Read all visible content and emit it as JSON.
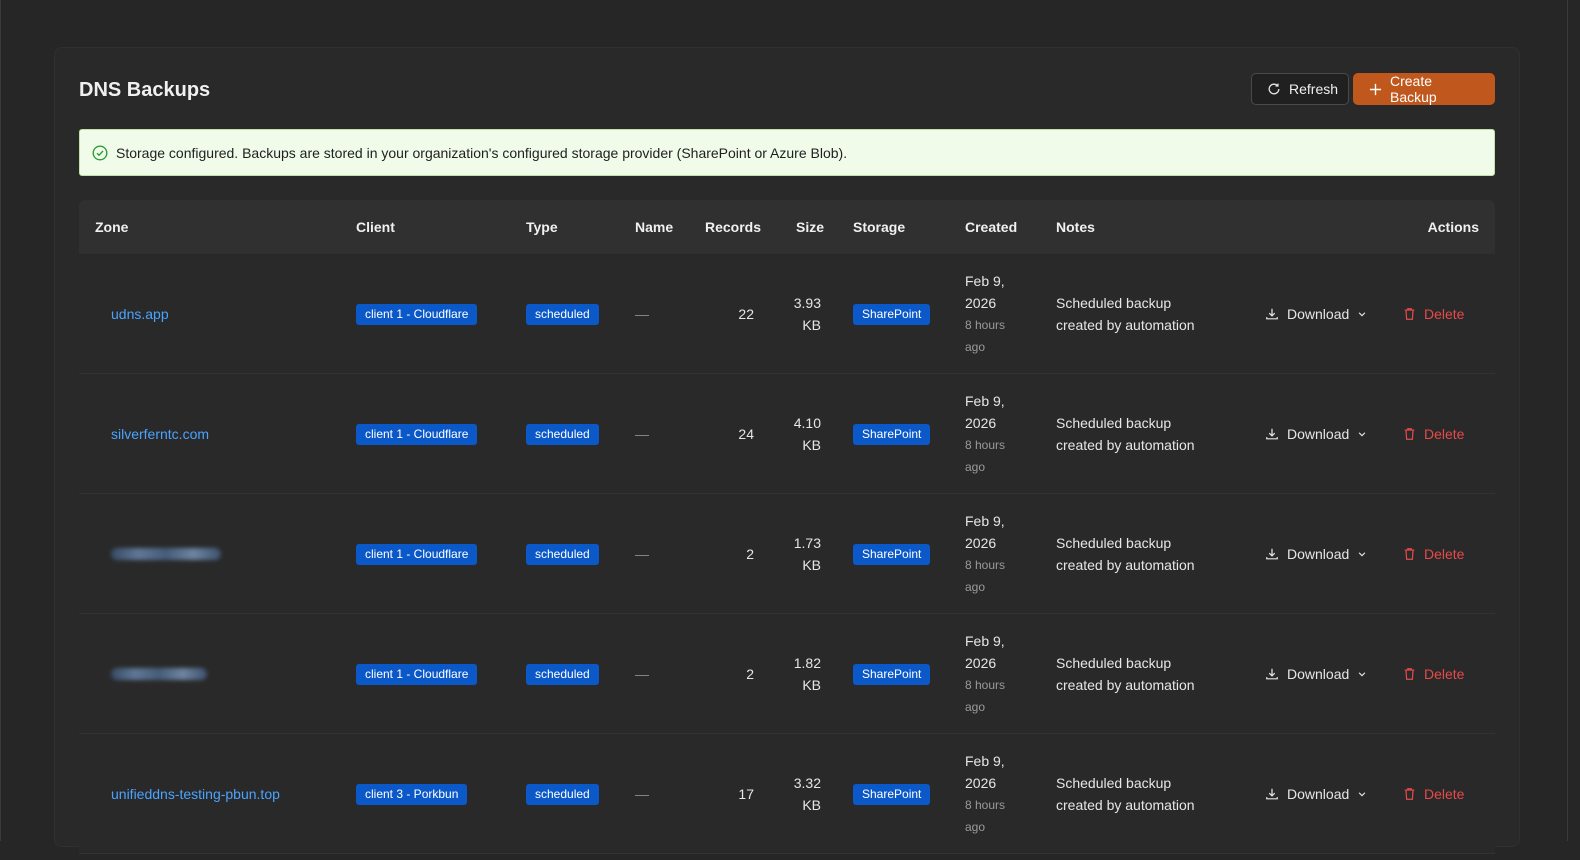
{
  "page": {
    "title": "DNS Backups",
    "refresh_label": "Refresh",
    "create_label": "Create Backup"
  },
  "banner": {
    "text": "Storage configured. Backups are stored in your organization's configured storage provider (SharePoint or Azure Blob)."
  },
  "table": {
    "columns": {
      "zone": "Zone",
      "client": "Client",
      "type": "Type",
      "name": "Name",
      "records": "Records",
      "size": "Size",
      "storage": "Storage",
      "created": "Created",
      "notes": "Notes",
      "actions": "Actions"
    },
    "rows": [
      {
        "zone": "udns.app",
        "client": "client 1 - Cloudflare",
        "type": "scheduled",
        "name": "—",
        "records": "22",
        "size_num": "3.93",
        "size_unit": "KB",
        "storage": "SharePoint",
        "created_date": "Feb 9,",
        "created_year": "2026",
        "created_rel_1": "8 hours",
        "created_rel_2": "ago",
        "notes_1": "Scheduled backup",
        "notes_2": "created by automation",
        "download": "Download",
        "delete": "Delete"
      },
      {
        "zone": "silverferntc.com",
        "client": "client 1 - Cloudflare",
        "type": "scheduled",
        "name": "—",
        "records": "24",
        "size_num": "4.10",
        "size_unit": "KB",
        "storage": "SharePoint",
        "created_date": "Feb 9,",
        "created_year": "2026",
        "created_rel_1": "8 hours",
        "created_rel_2": "ago",
        "notes_1": "Scheduled backup",
        "notes_2": "created by automation",
        "download": "Download",
        "delete": "Delete"
      },
      {
        "zone": "",
        "client": "client 1 - Cloudflare",
        "type": "scheduled",
        "name": "—",
        "records": "2",
        "size_num": "1.73",
        "size_unit": "KB",
        "storage": "SharePoint",
        "created_date": "Feb 9,",
        "created_year": "2026",
        "created_rel_1": "8 hours",
        "created_rel_2": "ago",
        "notes_1": "Scheduled backup",
        "notes_2": "created by automation",
        "download": "Download",
        "delete": "Delete"
      },
      {
        "zone": "",
        "client": "client 1 - Cloudflare",
        "type": "scheduled",
        "name": "—",
        "records": "2",
        "size_num": "1.82",
        "size_unit": "KB",
        "storage": "SharePoint",
        "created_date": "Feb 9,",
        "created_year": "2026",
        "created_rel_1": "8 hours",
        "created_rel_2": "ago",
        "notes_1": "Scheduled backup",
        "notes_2": "created by automation",
        "download": "Download",
        "delete": "Delete"
      },
      {
        "zone": "unifieddns-testing-pbun.top",
        "client": "client 3 - Porkbun",
        "type": "scheduled",
        "name": "—",
        "records": "17",
        "size_num": "3.32",
        "size_unit": "KB",
        "storage": "SharePoint",
        "created_date": "Feb 9,",
        "created_year": "2026",
        "created_rel_1": "8 hours",
        "created_rel_2": "ago",
        "notes_1": "Scheduled backup",
        "notes_2": "created by automation",
        "download": "Download",
        "delete": "Delete"
      }
    ]
  },
  "colors": {
    "accent": "#c0571c",
    "badge": "#0b58c9",
    "link": "#4aa3ff",
    "danger": "#e64a4a",
    "success": "#2e9e3a"
  }
}
